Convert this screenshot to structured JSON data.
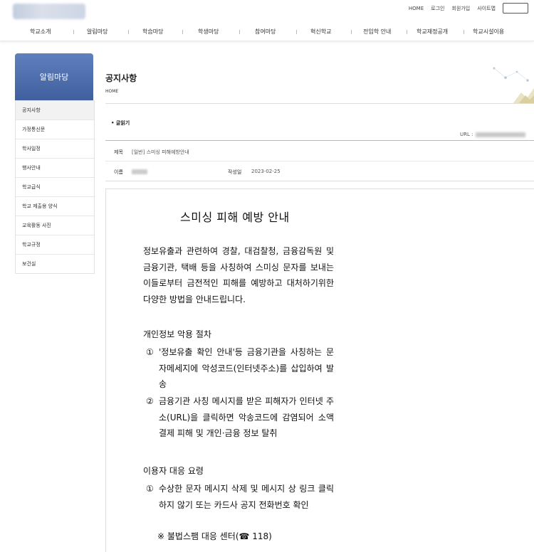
{
  "header": {
    "utility_links": [
      "HOME",
      "로그인",
      "회원가입",
      "사이트맵"
    ]
  },
  "gnb": [
    "학교소개",
    "알림마당",
    "학습마당",
    "학생마당",
    "참여마당",
    "혁신학교",
    "전입학 안내",
    "학교재정공개",
    "학교시설이용"
  ],
  "sidebar": {
    "title": "알림마당",
    "items": [
      "공지사항",
      "가정통신문",
      "학사일정",
      "행사안내",
      "학교급식",
      "학교 제출용 양식",
      "교육활동 사진",
      "학교규정",
      "보건실"
    ]
  },
  "page": {
    "title": "공지사항",
    "breadcrumb": "HOME",
    "read_label": "• 글읽기",
    "url_label": "URL :"
  },
  "post": {
    "subject_label": "제목",
    "subject": "[일반] 스미싱 피해예방안내",
    "name_label": "이름",
    "date_label": "작성일",
    "date": "2023-02-25"
  },
  "document": {
    "title": "스미싱 피해 예방 안내",
    "intro": " 정보유출과 관련하여 경찰, 대검찰청, 금융감독원 및 금융기관, 택배 등을 사칭하여 스미싱 문자를 보내는 이들로부터 금전적인 피해를 예방하고 대처하기위한 다양한 방법을 안내드립니다.",
    "section1_title": "개인정보 악용 절차",
    "section1_items": [
      {
        "num": "①",
        "text": "'정보유출 확인 안내'등 금융기관을 사칭하는 문자메세지에 악성코드(인터넷주소)를 삽입하여 발송"
      },
      {
        "num": "②",
        "text": "금융기관 사칭 메시지를 받은 피해자가 인터넷 주소(URL)을 클릭하면 악송코드에 감염되어 소액결제 피해 및 개인·금융 정보 탈취"
      }
    ],
    "section2_title": "이용자 대응 요령",
    "section2_items": [
      {
        "num": "①",
        "text": "수상한 문자 메시지 삭제 및 메시지 상 링크 클릭하지 않기 또는 카드사 공지 전화번호 확인"
      }
    ],
    "note": "※ 불법스팸 대응 센터(☎ 118)"
  },
  "colors": {
    "sidebar_title_bg": "#4a6aa8",
    "active_item_bg": "#f2f2f2"
  }
}
